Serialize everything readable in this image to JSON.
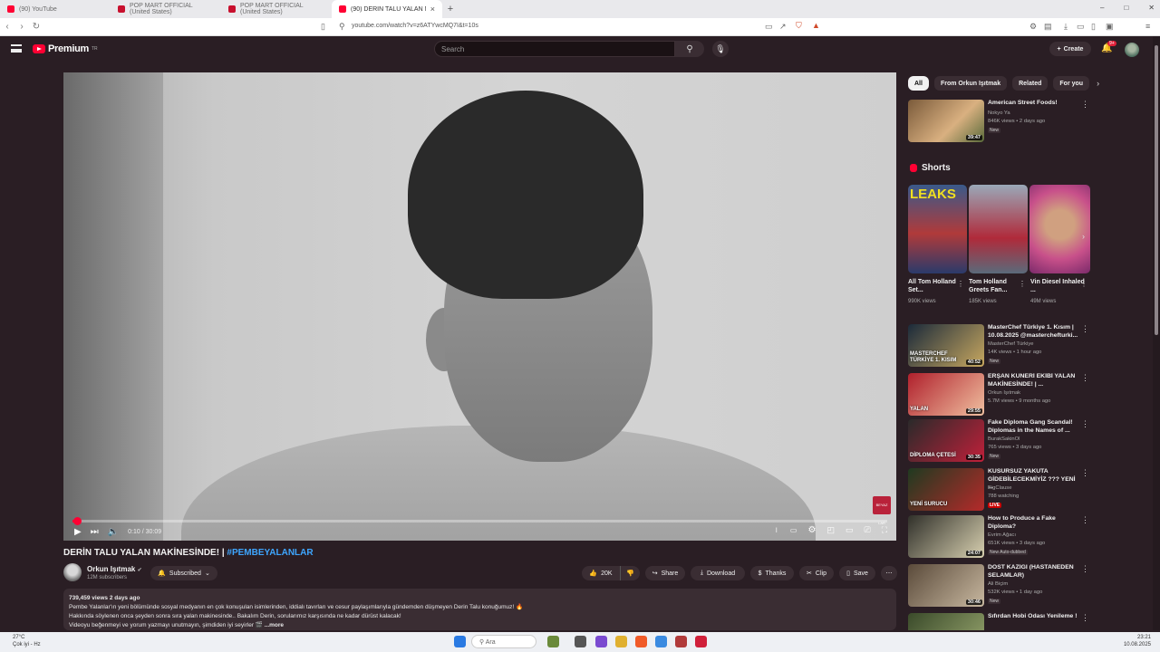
{
  "browser": {
    "tabs": [
      {
        "label": "(90) YouTube",
        "color": "#ff0033",
        "active": false
      },
      {
        "label": "POP MART OFFICIAL (United States)",
        "color": "#c8102e",
        "active": false
      },
      {
        "label": "POP MART OFFICIAL (United States)",
        "color": "#c8102e",
        "active": false
      },
      {
        "label": "(90) DERİN TALU YALAN MAKİNE",
        "color": "#ff0033",
        "active": true
      }
    ],
    "new_tab": "+",
    "url": "youtube.com/watch?v=z6ATYwcMQ7I&t=10s"
  },
  "header": {
    "logo_text": "Premium",
    "logo_sup": "TR",
    "search_placeholder": "Search",
    "create_label": "Create",
    "notif_count": "9+"
  },
  "player": {
    "time": "0:10 / 30:09",
    "progress_fraction": 0.006,
    "corner_logo": "BEYAZ LAR"
  },
  "video": {
    "title": "DERİN TALU YALAN MAKİNESİNDE! | ",
    "hashtag": "#PEMBEYALANLAR",
    "channel": "Orkun Işıtmak",
    "subscribers": "12M subscribers",
    "subscribed_label": "Subscribed",
    "likes": "20K",
    "share": "Share",
    "download": "Download",
    "thanks": "Thanks",
    "clip": "Clip",
    "save": "Save",
    "desc_meta": "739,459 views  2 days ago",
    "desc_line1": "Pembe Yalanlar'ın yeni bölümünde sosyal medyanın en çok konuşulan isimlerinden, iddialı tavırları ve cesur paylaşımlarıyla gündemden düşmeyen Derin Talu konuğumuz! 🔥",
    "desc_line2": "Hakkında söylenen onca şeyden sonra sıra yalan makinesinde.. Bakalım Derin, sorularımız karşısında ne kadar dürüst kalacak!",
    "desc_line3": "Videoyu beğenmeyi ve yorum yazmayı unutmayın, şimdiden iyi seyirler 🎬",
    "desc_more": "...more"
  },
  "sidebar": {
    "chips": [
      "All",
      "From Orkun Işıtmak",
      "Related",
      "For you"
    ],
    "first": {
      "title": "American Street Foods!",
      "channel": "Nokyo Ya",
      "meta": "846K views • 2 days ago",
      "badge": "New",
      "duration": "39:47"
    },
    "shorts_heading": "Shorts",
    "shorts": [
      {
        "title": "All Tom Holland Set...",
        "views": "990K views",
        "thumb_text": "LEAKS"
      },
      {
        "title": "Tom Holland Greets Fan...",
        "views": "185K views",
        "thumb_text": ""
      },
      {
        "title": "Vin Diesel Inhaled ...",
        "views": "49M views",
        "thumb_text": ""
      }
    ],
    "recs": [
      {
        "title": "MasterChef Türkiye 1. Kısım | 10.08.2025 @masterchefturki...",
        "channel": "MasterChef Türkiye",
        "meta": "14K views • 1 hour ago",
        "badge": "New",
        "duration": "40:52",
        "c1": "#1b2a3a",
        "c2": "#c8a860",
        "text": "MASTERCHEF TÜRKİYE 1. KISIM"
      },
      {
        "title": "ERŞAN KUNERİ EKİBİ YALAN MAKİNESİNDE! | ...",
        "channel": "Orkun Işıtmak",
        "meta": "5.7M views • 9 months ago",
        "badge": "",
        "duration": "29:55",
        "c1": "#b0202c",
        "c2": "#f0c0a0",
        "text": "YALAN"
      },
      {
        "title": "Fake Diploma Gang Scandal! Diplomas in the Names of ...",
        "channel": "BurakSakinOl",
        "meta": "765 views • 3 days ago",
        "badge": "New",
        "duration": "30:35",
        "c1": "#2a2a2a",
        "c2": "#c0203a",
        "text": "DİPLOMA ÇETESİ"
      },
      {
        "title": "KUSURSUZ YAKUTA GİDEBİLECEKMİYİZ ??? YENİ ...",
        "channel": "BigClause",
        "meta": "788 watching",
        "badge": "LIVE",
        "duration": "",
        "c1": "#1f3a20",
        "c2": "#b52a2a",
        "text": "YENİ SURUCU"
      },
      {
        "title": "How to Produce a Fake Diploma?",
        "channel": "Evrim Ağacı",
        "meta": "651K views • 3 days ago",
        "badge": "New  Auto-dubbed",
        "duration": "24:07",
        "c1": "#30302a",
        "c2": "#d8d0b0",
        "text": ""
      },
      {
        "title": "DOST KAZIĞI (HASTANEDEN SELAMLAR)",
        "channel": "Ali Biçim",
        "meta": "532K views • 1 day ago",
        "badge": "New",
        "duration": "30:46",
        "c1": "#5a4a3a",
        "c2": "#c8b8a0",
        "text": ""
      },
      {
        "title": "Sıfırdan Hobi Odası Yenileme !",
        "channel": "Nokyo Ya",
        "meta": "",
        "badge": "",
        "duration": "",
        "c1": "#3a4a2a",
        "c2": "#9aa870",
        "text": ""
      }
    ]
  },
  "taskbar": {
    "weather_line1": "27°C",
    "weather_line2": "Çok iyi - Hz",
    "search_label": "Ara",
    "clock_time": "23:21",
    "clock_date": "10.08.2025"
  }
}
